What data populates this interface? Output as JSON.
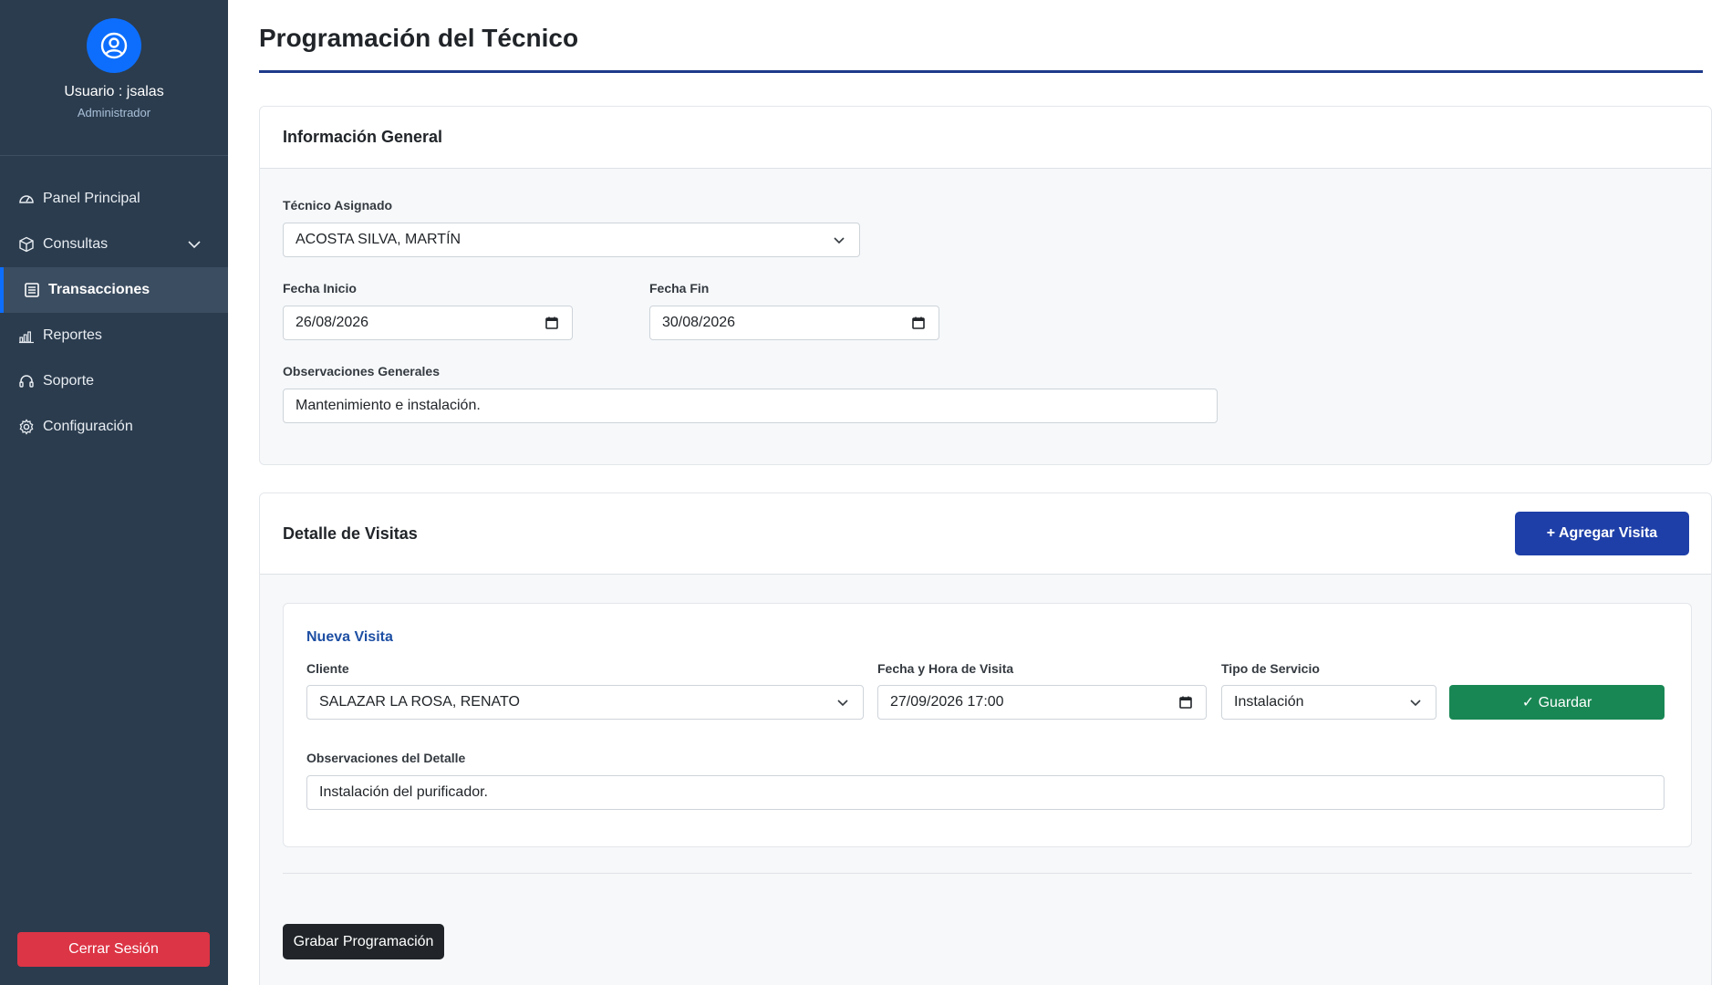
{
  "user": {
    "name": "Usuario : jsalas",
    "role": "Administrador"
  },
  "sidebar": {
    "items": [
      {
        "label": "Panel Principal",
        "icon": "dashboard-gauge-icon"
      },
      {
        "label": "Consultas",
        "icon": "box-icon",
        "has_submenu": true
      },
      {
        "label": "Transacciones",
        "icon": "list-icon",
        "active": true
      },
      {
        "label": "Reportes",
        "icon": "bar-chart-icon"
      },
      {
        "label": "Soporte",
        "icon": "headset-icon"
      },
      {
        "label": "Configuración",
        "icon": "gear-icon"
      }
    ],
    "logout_label": "Cerrar Sesión"
  },
  "page": {
    "title": "Programación del Técnico"
  },
  "general": {
    "header": "Información General",
    "technician_label": "Técnico Asignado",
    "technician_value": "ACOSTA SILVA, MARTÍN",
    "start_label": "Fecha Inicio",
    "start_value": "26/08/2026",
    "end_label": "Fecha Fin",
    "end_value": "30/08/2026",
    "notes_label": "Observaciones Generales",
    "notes_value": "Mantenimiento e instalación."
  },
  "visits": {
    "header": "Detalle de Visitas",
    "add_label": "+ Agregar Visita",
    "new_visit_title": "Nueva Visita",
    "client_label": "Cliente",
    "client_value": "SALAZAR LA ROSA, RENATO",
    "datetime_label": "Fecha y Hora de Visita",
    "datetime_value": "27/09/2026 17:00",
    "service_label": "Tipo de Servicio",
    "service_value": "Instalación",
    "save_label": "✓ Guardar",
    "detail_notes_label": "Observaciones del Detalle",
    "detail_notes_value": "Instalación del purificador.",
    "submit_label": "Grabar Programación"
  },
  "colors": {
    "sidebar_bg": "#2b3c4e",
    "accent_blue": "#1e3fa8",
    "danger": "#dc3545",
    "success": "#198754"
  }
}
